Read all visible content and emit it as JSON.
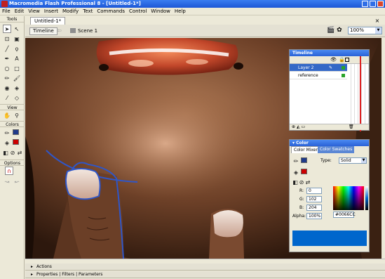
{
  "window": {
    "title": "Macromedia Flash Professional 8 - [Untitled-1*]"
  },
  "menu": [
    "File",
    "Edit",
    "View",
    "Insert",
    "Modify",
    "Text",
    "Commands",
    "Control",
    "Window",
    "Help"
  ],
  "tools": {
    "header": "Tools",
    "view": "View",
    "colors": "Colors",
    "options": "Options",
    "stroke_color": "#1f3a8a",
    "fill_color": "#cc0000"
  },
  "document": {
    "tab": "Untitled-1*",
    "timeline_button": "Timeline",
    "scene": "Scene 1",
    "zoom": "100%"
  },
  "timeline_panel": {
    "title": "Timeline",
    "layers": [
      {
        "name": "Layer 2",
        "active": true
      },
      {
        "name": "reference",
        "active": false
      }
    ]
  },
  "color_panel": {
    "title": "Color",
    "tabs": [
      "Color Mixer",
      "Color Swatches"
    ],
    "type_label": "Type:",
    "type_value": "Solid",
    "r_label": "R:",
    "r": "0",
    "g_label": "G:",
    "g": "102",
    "b_label": "B:",
    "b": "204",
    "alpha_label": "Alpha:",
    "alpha": "100%",
    "hex": "#0066CC",
    "swatch_color": "#0066cc"
  },
  "bottom_panels": {
    "actions": "Actions",
    "properties": "Properties",
    "filters": "Filters",
    "parameters": "Parameters"
  }
}
